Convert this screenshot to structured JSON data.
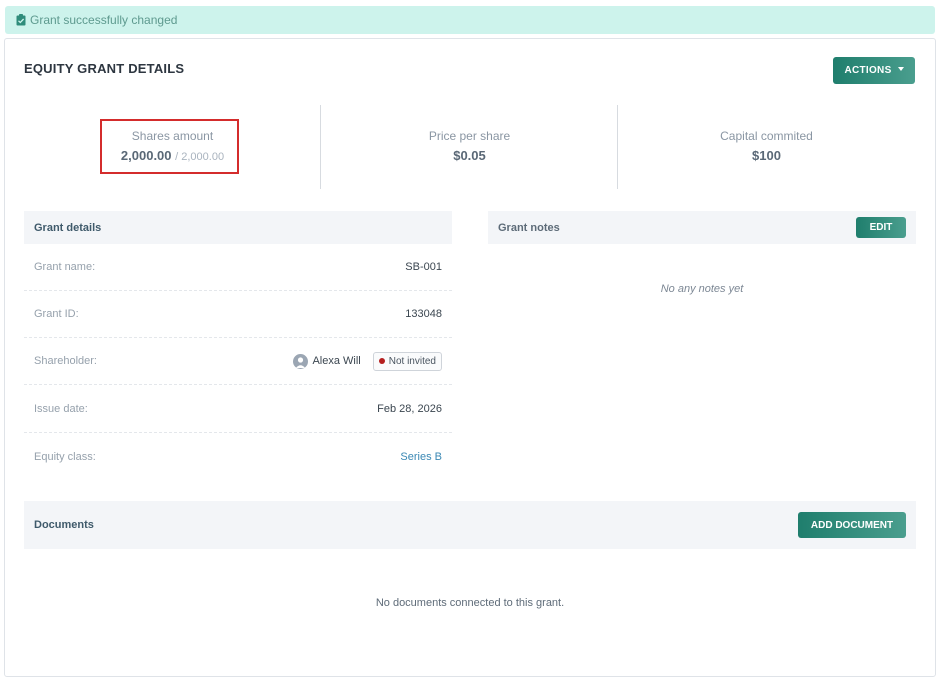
{
  "alert": {
    "text": "Grant successfully changed"
  },
  "card": {
    "title": "EQUITY GRANT DETAILS",
    "actions_label": "ACTIONS"
  },
  "stats": {
    "shares": {
      "label": "Shares amount",
      "value": "2,000.00",
      "sub": "/ 2,000.00"
    },
    "price": {
      "label": "Price per share",
      "value": "$0.05"
    },
    "capital": {
      "label": "Capital commited",
      "value": "$100"
    }
  },
  "grant_details": {
    "title": "Grant details",
    "rows": [
      {
        "key": "Grant name:",
        "value": "SB-001"
      },
      {
        "key": "Grant ID:",
        "value": "133048"
      },
      {
        "key": "Shareholder:",
        "value": "Alexa Will",
        "badge": "Not invited"
      },
      {
        "key": "Issue date:",
        "value": "Feb 28, 2026"
      },
      {
        "key": "Equity class:",
        "value": "Series B"
      }
    ]
  },
  "grant_notes": {
    "title": "Grant notes",
    "edit_label": "EDIT",
    "empty_text": "No any notes yet"
  },
  "documents": {
    "title": "Documents",
    "add_label": "ADD DOCUMENT",
    "empty_text": "No documents connected to this grant."
  },
  "colors": {
    "accent": "#1f7e6d",
    "alert_bg": "#cdf3ec",
    "highlight": "#d42c2c",
    "link": "#3a88b4",
    "status_dot": "#b51f1f"
  }
}
